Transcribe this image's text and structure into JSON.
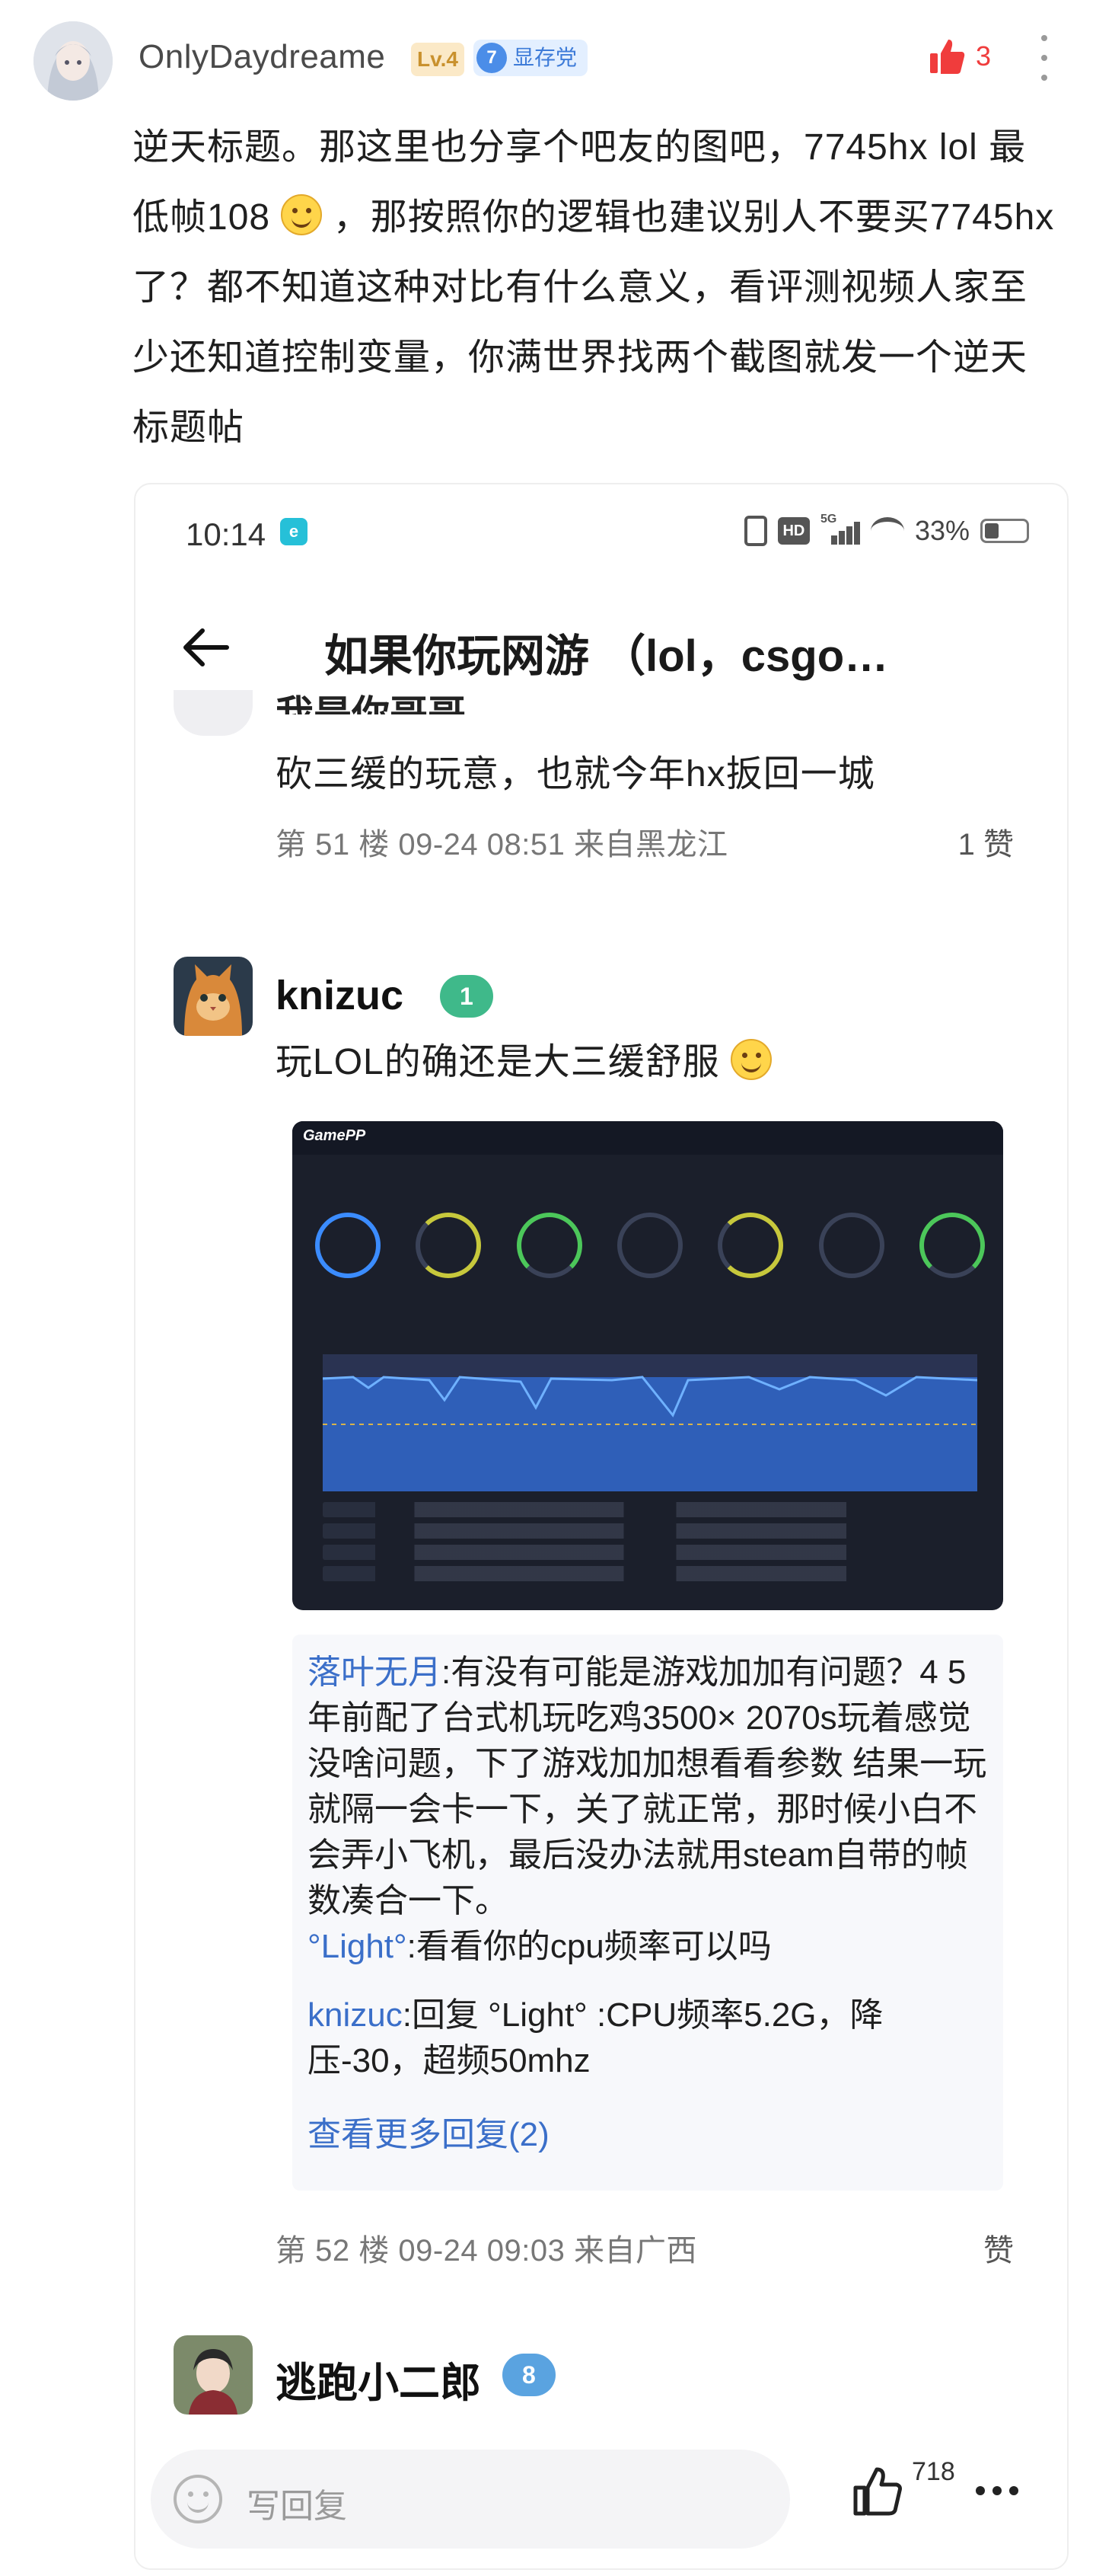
{
  "post": {
    "author": "OnlyDaydreame",
    "level_badge": "Lv.4",
    "member_badge_num": "7",
    "member_badge_label": "显存党",
    "like_count": "3",
    "text_p1": "逆天标题。那这里也分享个吧友的图吧，7745hx lol 最低帧108",
    "text_p2": "，那按照你的逻辑也建议别人不要买7745hx了？都不知道这种对比有什么意义，看评测视频人家至少还知道控制变量，你满世界找两个截图就发一个逆天标题帖"
  },
  "screenshot": {
    "status_bar": {
      "time": "10:14",
      "app_icon": "e",
      "hd": "HD",
      "network": "5G",
      "battery": "33%"
    },
    "nav": {
      "title": "如果你玩网游 （lol，csgo…"
    },
    "prev_floor": {
      "name_partial": "我是你哥哥",
      "reply": "砍三缓的玩意，也就今年hx扳回一城",
      "meta": "第 51 楼 09-24 08:51 来自黑龙江",
      "like": "1 赞"
    },
    "floor52": {
      "user": "knizuc",
      "level": "1",
      "reply": "玩LOL的确还是大三缓舒服",
      "game_logo": "GamePP",
      "sub_replies": [
        {
          "name": "落叶无月",
          "text": ":有没有可能是游戏加加有问题？4 5年前配了台式机玩吃鸡3500× 2070s玩着感觉没啥问题，下了游戏加加想看看参数 结果一玩就隔一会卡一下，关了就正常，那时候小白不会弄小飞机，最后没办法就用steam自带的帧数凑合一下。"
        },
        {
          "name": "°Light°",
          "text": ":看看你的cpu频率可以吗"
        },
        {
          "name": "knizuc",
          "text": ":回复 °Light° :CPU频率5.2G，降压-30，超频50mhz"
        }
      ],
      "more_replies": "查看更多回复(2)",
      "meta": "第 52 楼 09-24 09:03 来自广西",
      "like": "赞"
    },
    "next_floor": {
      "user": "逃跑小二郎",
      "level": "8"
    },
    "bottom_bar": {
      "placeholder": "写回复",
      "like_count": "718"
    }
  },
  "colors": {
    "like_red": "#f03c3c",
    "link_blue": "#3b6fc9",
    "level_green": "#3fb98a",
    "level_blue": "#5aa3e0"
  }
}
